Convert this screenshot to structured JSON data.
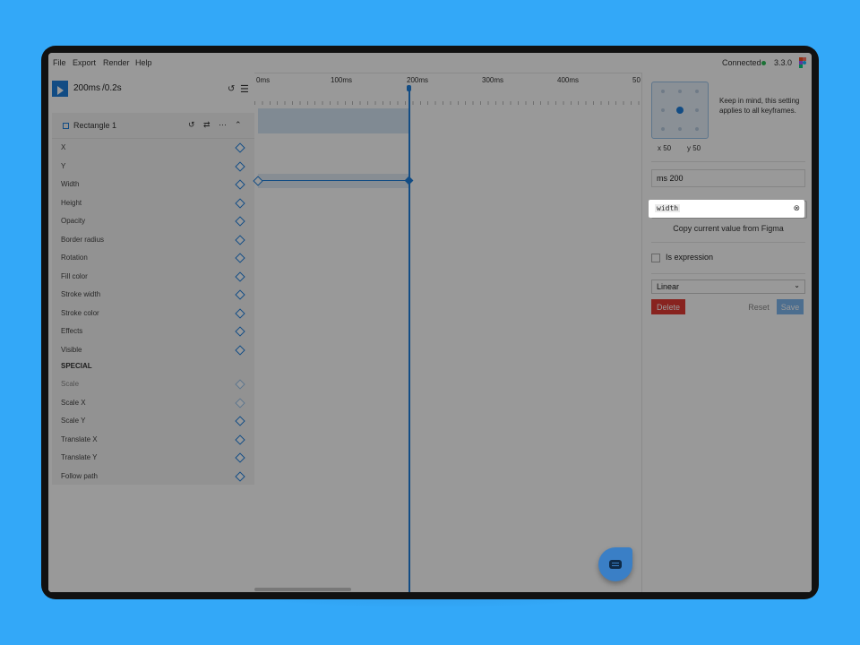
{
  "menubar": {
    "items": [
      "File",
      "Export",
      "Render",
      "Help"
    ],
    "status": "Connected",
    "version": "3.3.0"
  },
  "player": {
    "current_time": "200ms",
    "total_time": "/0.2s"
  },
  "layer": {
    "name": "Rectangle 1",
    "properties": [
      "X",
      "Y",
      "Width",
      "Height",
      "Opacity",
      "Border radius",
      "Rotation",
      "Fill color",
      "Stroke width",
      "Stroke color",
      "Effects",
      "Visible"
    ],
    "special_heading": "SPECIAL",
    "special_properties": [
      "Scale",
      "Scale X",
      "Scale Y",
      "Translate X",
      "Translate Y",
      "Follow path"
    ]
  },
  "timeline": {
    "ticks": [
      "0ms",
      "100ms",
      "200ms",
      "300ms",
      "400ms",
      "50"
    ]
  },
  "inspector": {
    "origin_note": "Keep in mind, this setting applies to all keyframes.",
    "x_label": "x 50",
    "y_label": "y 50",
    "time_value": "ms 200",
    "property_code": "width",
    "copy_button": "Copy current value from Figma",
    "expression_label": "Is expression",
    "easing": "Linear",
    "delete_label": "Delete",
    "reset_label": "Reset",
    "save_label": "Save"
  },
  "colors": {
    "accent": "#1e7fdc",
    "danger": "#e33b35",
    "background": "#33a8f8"
  }
}
